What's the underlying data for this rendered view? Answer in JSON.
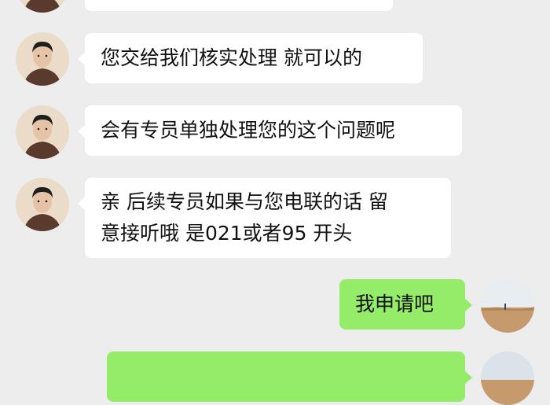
{
  "messages": [
    {
      "side": "left",
      "lines": [
        ""
      ]
    },
    {
      "side": "left",
      "lines": [
        "您交给我们核实处理 就可以的"
      ]
    },
    {
      "side": "left",
      "lines": [
        "会有专员单独处理您的这个问题呢"
      ]
    },
    {
      "side": "left",
      "lines": [
        "亲 后续专员如果与您电联的话 留",
        "意接听哦 是021或者95 开头"
      ]
    },
    {
      "side": "right",
      "lines": [
        "我申请吧"
      ]
    },
    {
      "side": "right",
      "lines": [
        ""
      ]
    }
  ],
  "colors": {
    "background": "#ededed",
    "incoming_bubble": "#ffffff",
    "outgoing_bubble": "#95ec69"
  }
}
